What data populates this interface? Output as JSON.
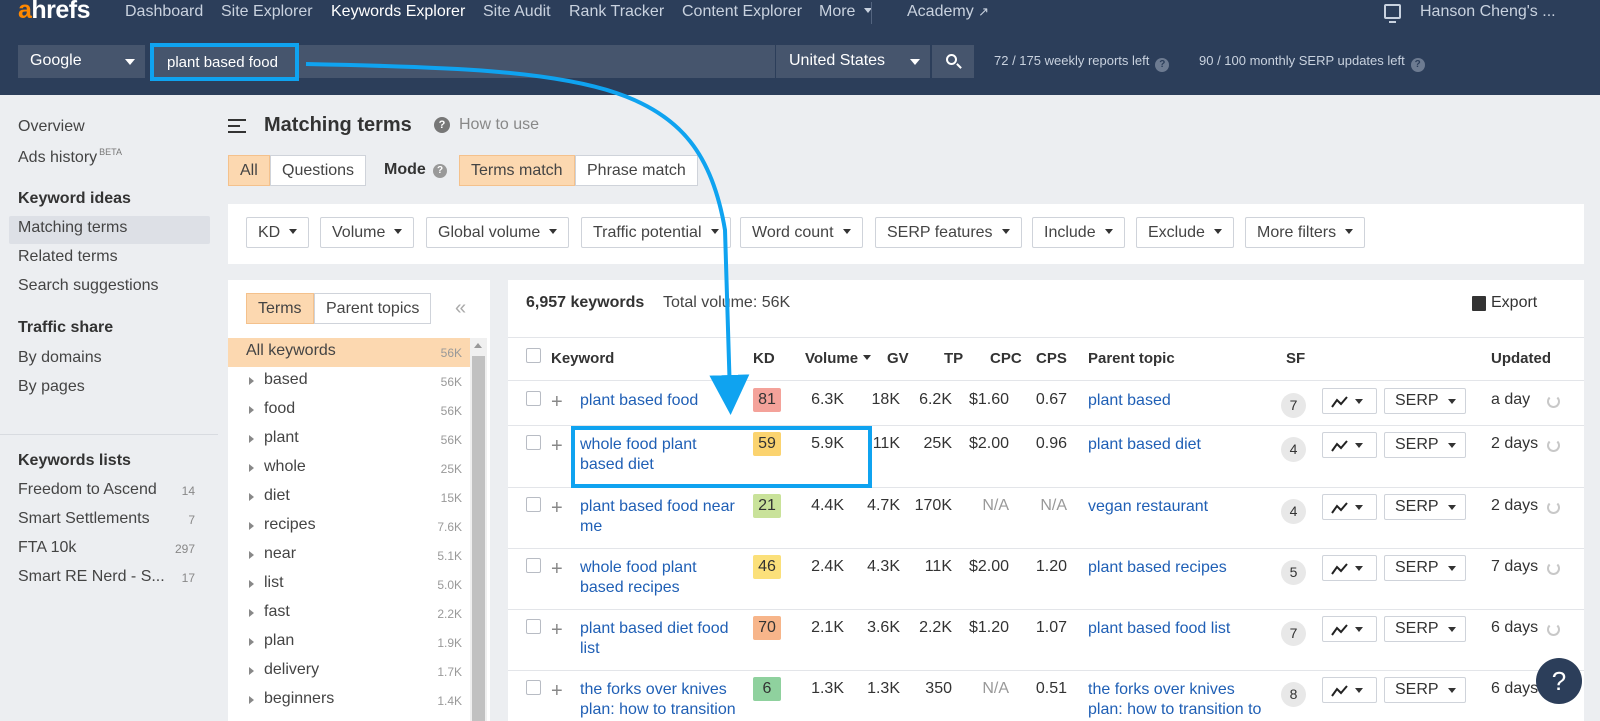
{
  "nav": {
    "logo_a": "a",
    "logo_rest": "hrefs",
    "items": [
      "Dashboard",
      "Site Explorer",
      "Keywords Explorer",
      "Site Audit",
      "Rank Tracker",
      "Content Explorer",
      "More",
      "Academy"
    ],
    "user": "Hanson Cheng's ..."
  },
  "search": {
    "engine": "Google",
    "query": "plant based food",
    "country": "United States",
    "weekly_reports": "72 / 175 weekly reports left",
    "monthly_serp": "90 / 100 monthly SERP updates left"
  },
  "sidebar": {
    "overview": "Overview",
    "ads_history": "Ads history",
    "beta": "BETA",
    "keyword_ideas_head": "Keyword ideas",
    "keyword_ideas": [
      "Matching terms",
      "Related terms",
      "Search suggestions"
    ],
    "traffic_share_head": "Traffic share",
    "traffic_share": [
      "By domains",
      "By pages"
    ],
    "keywords_lists_head": "Keywords lists",
    "keywords_lists": [
      {
        "name": "Freedom to Ascend",
        "count": "14"
      },
      {
        "name": "Smart Settlements",
        "count": "7"
      },
      {
        "name": "FTA 10k",
        "count": "297"
      },
      {
        "name": "Smart RE Nerd - S...",
        "count": "17"
      }
    ]
  },
  "header": {
    "title": "Matching terms",
    "how_to": "How to use",
    "tabs": [
      "All",
      "Questions"
    ],
    "mode_label": "Mode",
    "modes": [
      "Terms match",
      "Phrase match"
    ]
  },
  "filters": [
    "KD",
    "Volume",
    "Global volume",
    "Traffic potential",
    "Word count",
    "SERP features",
    "Include",
    "Exclude",
    "More filters"
  ],
  "left_panel": {
    "tabs": [
      "Terms",
      "Parent topics"
    ],
    "rows": [
      {
        "label": "All keywords",
        "count": "56K"
      },
      {
        "label": "based",
        "count": "56K"
      },
      {
        "label": "food",
        "count": "56K"
      },
      {
        "label": "plant",
        "count": "56K"
      },
      {
        "label": "whole",
        "count": "25K"
      },
      {
        "label": "diet",
        "count": "15K"
      },
      {
        "label": "recipes",
        "count": "7.6K"
      },
      {
        "label": "near",
        "count": "5.1K"
      },
      {
        "label": "list",
        "count": "5.0K"
      },
      {
        "label": "fast",
        "count": "2.2K"
      },
      {
        "label": "plan",
        "count": "1.9K"
      },
      {
        "label": "delivery",
        "count": "1.7K"
      },
      {
        "label": "beginners",
        "count": "1.4K"
      }
    ]
  },
  "table": {
    "keyword_count": "6,957 keywords",
    "total_volume": "Total volume: 56K",
    "export": "Export",
    "columns": [
      "Keyword",
      "KD",
      "Volume",
      "GV",
      "TP",
      "CPC",
      "CPS",
      "Parent topic",
      "SF",
      "Updated"
    ],
    "serp_label": "SERP",
    "rows": [
      {
        "kw1": "plant based food",
        "kw2": "",
        "kd": "81",
        "kd_color": "#f4a29a",
        "volume": "6.3K",
        "gv": "18K",
        "tp": "6.2K",
        "cpc": "$1.60",
        "cps": "0.67",
        "parent1": "plant based",
        "parent2": "",
        "sf": "7",
        "updated": "a day"
      },
      {
        "kw1": "whole food plant",
        "kw2": "based diet",
        "kd": "59",
        "kd_color": "#fbd36f",
        "volume": "5.9K",
        "gv": "11K",
        "tp": "25K",
        "cpc": "$2.00",
        "cps": "0.96",
        "parent1": "plant based diet",
        "parent2": "",
        "sf": "4",
        "updated": "2 days"
      },
      {
        "kw1": "plant based food near",
        "kw2": "me",
        "kd": "21",
        "kd_color": "#c9e29a",
        "volume": "4.4K",
        "gv": "4.7K",
        "tp": "170K",
        "cpc": "N/A",
        "cps": "N/A",
        "parent1": "vegan restaurant",
        "parent2": "",
        "sf": "4",
        "updated": "2 days"
      },
      {
        "kw1": "whole food plant",
        "kw2": "based recipes",
        "kd": "46",
        "kd_color": "#fbe07a",
        "volume": "2.4K",
        "gv": "4.3K",
        "tp": "11K",
        "cpc": "$2.00",
        "cps": "1.20",
        "parent1": "plant based recipes",
        "parent2": "",
        "sf": "5",
        "updated": "7 days"
      },
      {
        "kw1": "plant based diet food",
        "kw2": "list",
        "kd": "70",
        "kd_color": "#f7b58a",
        "volume": "2.1K",
        "gv": "3.6K",
        "tp": "2.2K",
        "cpc": "$1.20",
        "cps": "1.07",
        "parent1": "plant based food list",
        "parent2": "",
        "sf": "7",
        "updated": "6 days"
      },
      {
        "kw1": "the forks over knives",
        "kw2": "plan: how to transition",
        "kd": "6",
        "kd_color": "#8fd19e",
        "volume": "1.3K",
        "gv": "1.3K",
        "tp": "350",
        "cpc": "N/A",
        "cps": "0.51",
        "parent1": "the forks over knives",
        "parent2": "plan: how to transition to",
        "sf": "8",
        "updated": "6 days"
      }
    ]
  },
  "help_fab": "?",
  "colors": {
    "nav_bg": "#2c3e5a",
    "highlight": "#0fa3f0",
    "orange_tab": "#fcd8b0",
    "link": "#1f5fb5"
  }
}
